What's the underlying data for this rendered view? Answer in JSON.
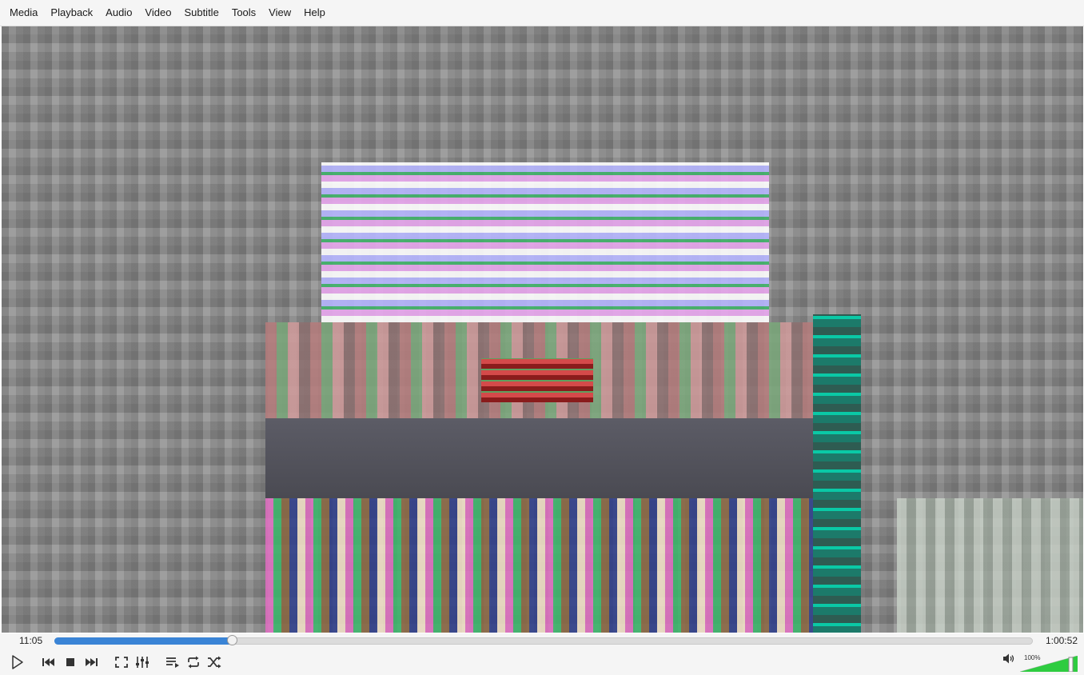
{
  "menu": {
    "items": [
      "Media",
      "Playback",
      "Audio",
      "Video",
      "Subtitle",
      "Tools",
      "View",
      "Help"
    ]
  },
  "seek": {
    "elapsed": "11:05",
    "total": "1:00:52",
    "progress_fraction": 0.182
  },
  "controls": {
    "icons": [
      "play-icon",
      "previous-icon",
      "stop-icon",
      "next-icon",
      "fullscreen-icon",
      "extended-settings-icon",
      "playlist-icon",
      "loop-icon",
      "shuffle-icon"
    ]
  },
  "volume": {
    "label": "100%",
    "level_fraction": 1.0
  },
  "colors": {
    "accent": "#3a84d6",
    "volume_fill": "#2ecc40"
  }
}
